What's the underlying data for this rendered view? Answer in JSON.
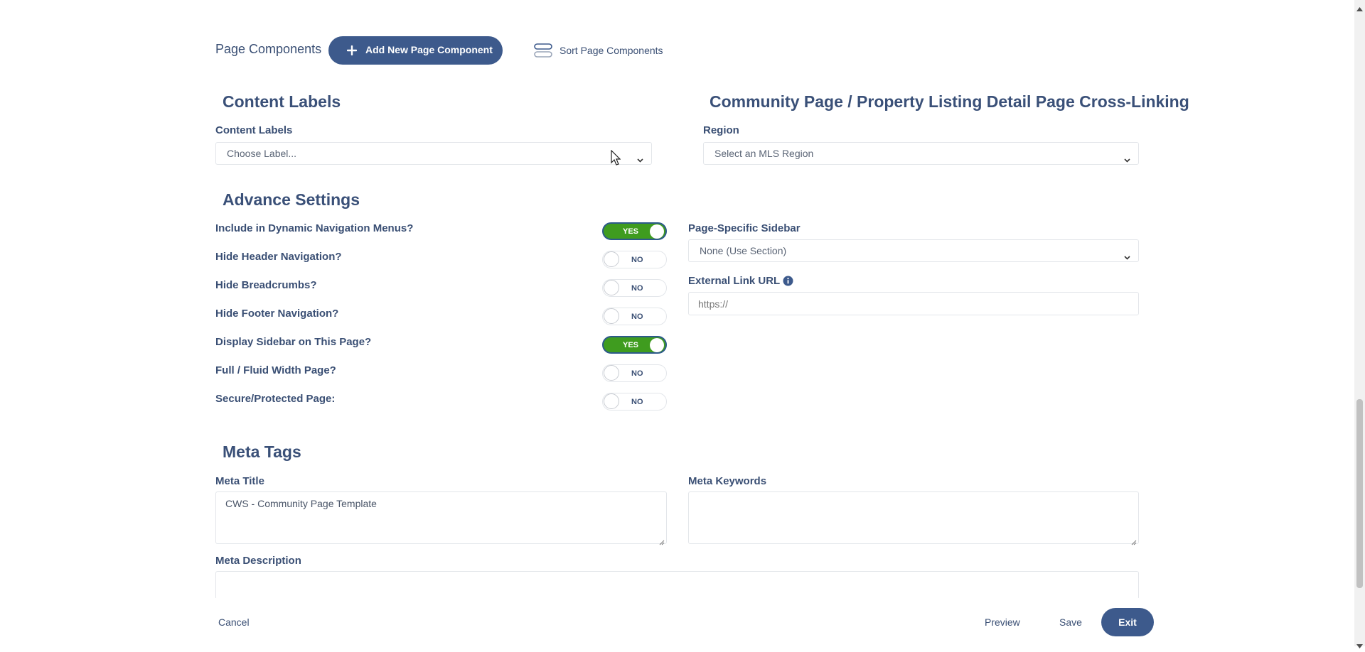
{
  "top": {
    "page_components_label": "Page Components",
    "add_button_label": "Add New Page Component",
    "sort_label": "Sort Page Components"
  },
  "content_labels": {
    "section_title": "Content Labels",
    "field_label": "Content Labels",
    "select_value": "Choose Label..."
  },
  "cross_linking": {
    "section_title": "Community Page / Property Listing Detail Page Cross-Linking",
    "field_label": "Region",
    "select_value": "Select an MLS Region"
  },
  "advance": {
    "section_title": "Advance Settings",
    "toggles": [
      {
        "label": "Include in Dynamic Navigation Menus?",
        "state": "YES"
      },
      {
        "label": "Hide Header Navigation?",
        "state": "NO"
      },
      {
        "label": "Hide Breadcrumbs?",
        "state": "NO"
      },
      {
        "label": "Hide Footer Navigation?",
        "state": "NO"
      },
      {
        "label": "Display Sidebar on This Page?",
        "state": "YES"
      },
      {
        "label": "Full / Fluid Width Page?",
        "state": "NO"
      },
      {
        "label": "Secure/Protected Page:",
        "state": "NO"
      }
    ],
    "sidebar_label": "Page-Specific Sidebar",
    "sidebar_value": "None (Use Section)",
    "external_link_label": "External Link URL",
    "external_link_placeholder": "https://"
  },
  "meta": {
    "section_title": "Meta Tags",
    "title_label": "Meta Title",
    "title_value": "CWS - Community Page Template",
    "keywords_label": "Meta Keywords",
    "keywords_value": "",
    "description_label": "Meta Description",
    "description_value": ""
  },
  "footer": {
    "cancel": "Cancel",
    "preview": "Preview",
    "save": "Save",
    "exit": "Exit"
  },
  "colors": {
    "primary": "#3d5a8c",
    "toggle_on": "#3f9c1f",
    "heading": "#3a5078"
  },
  "icons": [
    "plus-icon",
    "sort-icon",
    "chevron-down-icon",
    "info-icon",
    "mouse-cursor-icon"
  ]
}
